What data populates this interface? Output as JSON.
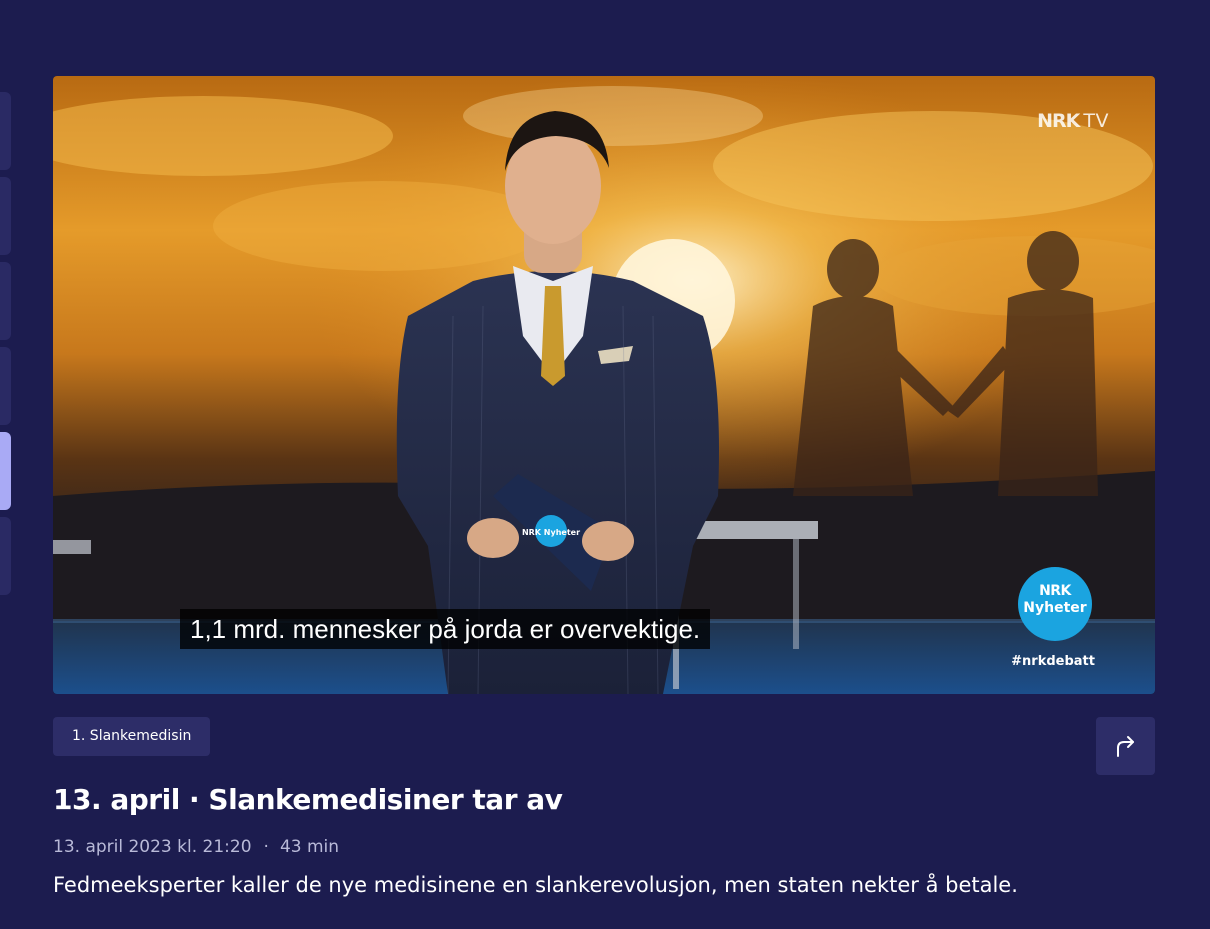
{
  "player": {
    "logo_brand": "NRK",
    "logo_suffix": "TV",
    "subtitle": "1,1 mrd. mennesker på jorda er overvektige.",
    "badge_line1": "NRK",
    "badge_line2": "Nyheter",
    "hashtag": "#nrkdebatt",
    "card_brand": "NRK Nyheter"
  },
  "episode": {
    "chip_label": "1. Slankemedisin",
    "title": "13. april · Slankemedisiner tar av",
    "date": "13. april 2023 kl. 21:20",
    "separator": "·",
    "duration": "43 min",
    "description": "Fedmeeksperter kaller de nye medisinene en slankerevolusjon, men staten nekter å betale."
  },
  "icons": {
    "share": "share-arrow-icon"
  },
  "colors": {
    "background": "#1c1c4f",
    "chip": "#2d2d68",
    "active_rail": "#a9aaf5",
    "badge": "#1ba4e0",
    "meta_text": "#b9bad8"
  }
}
